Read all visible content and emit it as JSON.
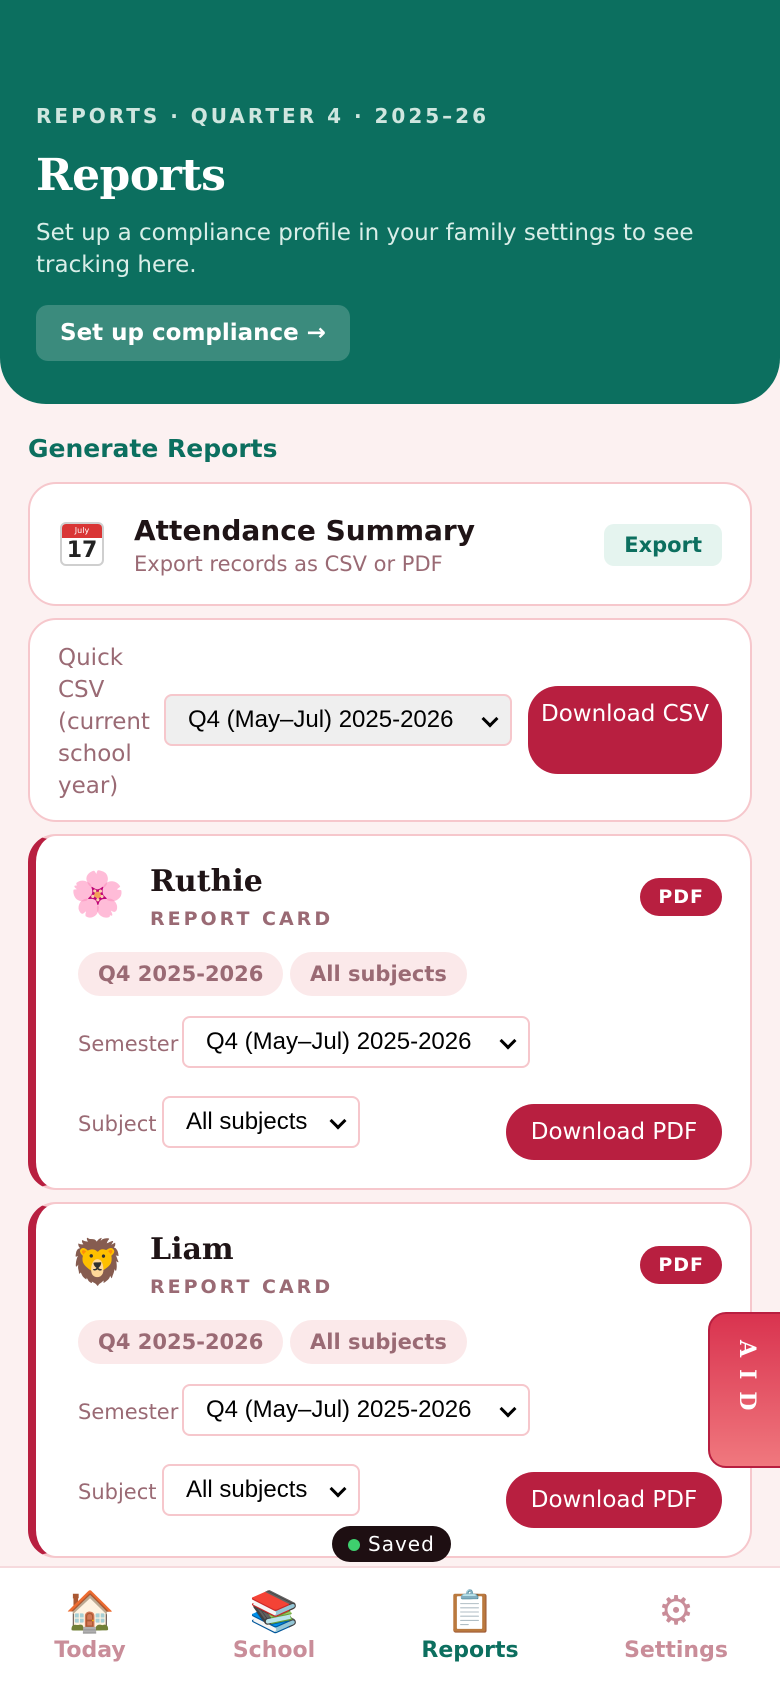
{
  "hero": {
    "eyebrow": "REPORTS · QUARTER 4 · 2025–26",
    "title": "Reports",
    "subtitle": "Set up a compliance profile in your family settings to see tracking here.",
    "button": "Set up compliance →"
  },
  "section_title": "Generate Reports",
  "attendance": {
    "icon": "calendar-icon",
    "icon_month": "July",
    "icon_day": "17",
    "title": "Attendance Summary",
    "subtitle": "Export records as CSV or PDF",
    "button": "Export"
  },
  "quick_csv": {
    "label": "Quick CSV (current school year)",
    "selected": "Q4 (May–Jul) 2025-2026",
    "button": "Download CSV"
  },
  "report_cards": [
    {
      "avatar": "🌸",
      "name": "Ruthie",
      "label": "REPORT CARD",
      "badge": "PDF",
      "chips": [
        "Q4 2025-2026",
        "All subjects"
      ],
      "semester_label": "Semester",
      "semester_value": "Q4 (May–Jul) 2025-2026",
      "subject_label": "Subject",
      "subject_value": "All subjects",
      "button": "Download PDF"
    },
    {
      "avatar": "🦁",
      "name": "Liam",
      "label": "REPORT CARD",
      "badge": "PDF",
      "chips": [
        "Q4 2025-2026",
        "All subjects"
      ],
      "semester_label": "Semester",
      "semester_value": "Q4 (May–Jul) 2025-2026",
      "subject_label": "Subject",
      "subject_value": "All subjects",
      "button": "Download PDF"
    }
  ],
  "aid_tab": "AID",
  "toast": "Saved",
  "tabbar": [
    {
      "icon": "🏠",
      "label": "Today",
      "active": false
    },
    {
      "icon": "📚",
      "label": "School",
      "active": false
    },
    {
      "icon": "📋",
      "label": "Reports",
      "active": true
    },
    {
      "icon": "⚙",
      "label": "Settings",
      "active": false
    }
  ],
  "colors": {
    "primary": "#0c6f5f",
    "accent": "#b81f40",
    "background": "#fcf1f1"
  }
}
